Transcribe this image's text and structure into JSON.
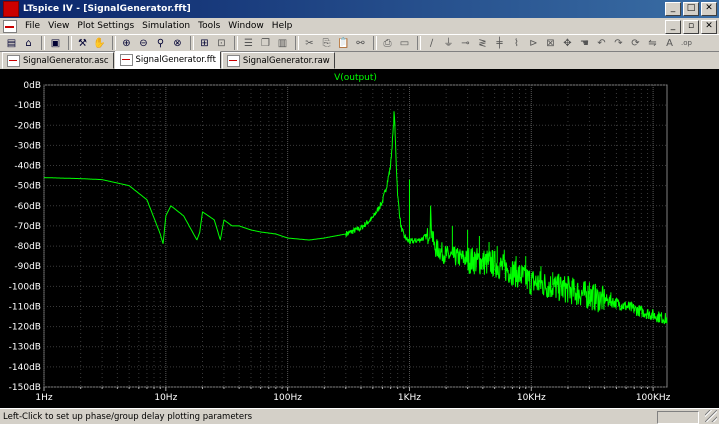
{
  "window": {
    "title": "LTspice IV - [SignalGenerator.fft]"
  },
  "menu": [
    "File",
    "View",
    "Plot Settings",
    "Simulation",
    "Tools",
    "Window",
    "Help"
  ],
  "tabs": [
    {
      "label": "SignalGenerator.asc"
    },
    {
      "label": "SignalGenerator.fft"
    },
    {
      "label": "SignalGenerator.raw"
    }
  ],
  "toolbar_icons": [
    "new-schematic-icon",
    "open-icon",
    "save-icon",
    "control-panel-icon",
    "hand-icon",
    "zoom-in-icon",
    "zoom-out-icon",
    "zoom-icon",
    "zoom-cancel-icon",
    "autorange-icon",
    "fit-icon",
    "tile-horizontal-icon",
    "cascade-icon",
    "tile-vertical-icon",
    "cut-icon",
    "copy-icon",
    "paste-icon",
    "find-icon",
    "print-icon",
    "print-preview-icon",
    "wire-icon",
    "ground-icon",
    "label-icon",
    "resistor-icon",
    "capacitor-icon",
    "inductor-icon",
    "diode-icon",
    "component-icon",
    "move-icon",
    "drag-icon",
    "undo-icon",
    "redo-icon",
    "rotate-icon",
    "mirror-icon",
    "text-icon",
    "spice-directive-icon"
  ],
  "status": {
    "text": "Left-Click to set up phase/group delay plotting parameters"
  },
  "colors": {
    "trace": "#00ff00",
    "plot_background": "#000000",
    "grid": "#3a3a3a",
    "axis_text": "#ffffff",
    "title_bar": "#0a246a"
  },
  "chart_data": {
    "type": "line",
    "title": "V(output)",
    "xscale": "log",
    "xlim": [
      1,
      130000
    ],
    "ylim": [
      -150,
      0
    ],
    "y_ticks": [
      "0dB",
      "-10dB",
      "-20dB",
      "-30dB",
      "-40dB",
      "-50dB",
      "-60dB",
      "-70dB",
      "-80dB",
      "-90dB",
      "-100dB",
      "-110dB",
      "-120dB",
      "-130dB",
      "-140dB",
      "-150dB"
    ],
    "x_ticks": [
      "1Hz",
      "10Hz",
      "100Hz",
      "1KHz",
      "10KHz",
      "100KHz"
    ],
    "series": [
      {
        "name": "V(output)",
        "x": [
          1,
          2,
          3,
          5,
          7,
          9,
          9.5,
          10,
          11,
          14,
          18,
          19,
          20,
          25,
          28,
          29,
          30,
          35,
          40,
          50,
          60,
          80,
          100,
          150,
          200,
          300,
          400,
          500,
          600,
          650,
          700,
          720,
          740,
          750,
          760,
          780,
          800,
          850,
          900,
          1000,
          1200,
          1400,
          1480,
          1500,
          1520,
          1600,
          2000,
          3000,
          5000,
          7000,
          10000,
          20000,
          30000,
          50000,
          70000,
          100000,
          130000
        ],
        "y": [
          -46,
          -46.5,
          -47,
          -50,
          -57,
          -74,
          -79,
          -65,
          -60,
          -65,
          -77,
          -73,
          -63,
          -67,
          -77,
          -72,
          -67,
          -70,
          -70,
          -72,
          -73,
          -74,
          -76,
          -77,
          -76,
          -74,
          -71,
          -66,
          -58,
          -50,
          -40,
          -30,
          -20,
          -12,
          -22,
          -40,
          -55,
          -70,
          -75,
          -78,
          -77,
          -75,
          -70,
          -60,
          -72,
          -80,
          -84,
          -86,
          -88,
          -92,
          -97,
          -101,
          -104,
          -108,
          -111,
          -114,
          -116
        ]
      }
    ],
    "peaks": [
      {
        "x": 750,
        "y": -12
      },
      {
        "x": 1000,
        "y": -47
      },
      {
        "x": 1500,
        "y": -60
      },
      {
        "x": 2250,
        "y": -70
      },
      {
        "x": 3000,
        "y": -72
      },
      {
        "x": 3750,
        "y": -75
      },
      {
        "x": 4500,
        "y": -78
      },
      {
        "x": 5250,
        "y": -80
      },
      {
        "x": 6000,
        "y": -82
      },
      {
        "x": 7500,
        "y": -85
      },
      {
        "x": 9000,
        "y": -85
      },
      {
        "x": 12000,
        "y": -90
      },
      {
        "x": 15000,
        "y": -93
      },
      {
        "x": 20000,
        "y": -95
      },
      {
        "x": 30000,
        "y": -98
      },
      {
        "x": 45000,
        "y": -103
      }
    ],
    "grid": true
  }
}
